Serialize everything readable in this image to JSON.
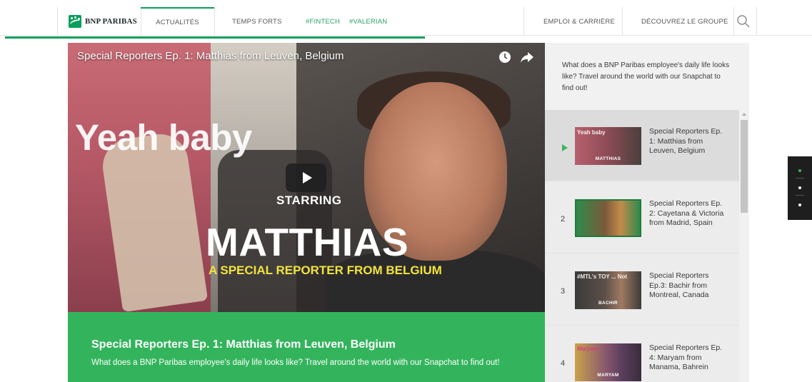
{
  "header": {
    "brand": "BNP PARIBAS",
    "nav_left": [
      "ACTUALITÉS",
      "TEMPS FORTS",
      "#FINTECH",
      "#VALERIAN"
    ],
    "nav_right": [
      "EMPLOI & CARRIÈRE",
      "DÉCOUVREZ LE GROUPE"
    ],
    "search_icon": "search-icon",
    "reading_progress": 0.52
  },
  "video": {
    "title": "Special Reporters Ep. 1: Matthias from Leuven, Belgium",
    "overlay_yeah": "Yeah baby",
    "overlay_starring": "STARRING",
    "overlay_name": "MATTHIAS",
    "overlay_subtitle": "A SPECIAL REPORTER FROM BELGIUM",
    "icons": [
      "clock-icon",
      "share-icon",
      "play-icon"
    ]
  },
  "caption": {
    "title": "Special Reporters Ep. 1: Matthias from Leuven, Belgium",
    "description": "What does a BNP Paribas employee's daily life looks like? Travel around the world with our Snapchat to find out!"
  },
  "sidebar": {
    "intro": "What does a BNP Paribas employee's daily life looks like? Travel around the world with our Snapchat to find out!",
    "playlist": [
      {
        "number": "",
        "active": true,
        "title": "Special Reporters Ep. 1: Matthias from Leuven, Belgium",
        "thumb_label": "MATTHIAS",
        "thumb_top": "Yeah baby"
      },
      {
        "number": "2",
        "active": false,
        "title": "Special Reporters Ep. 2: Cayetana & Victoria from Madrid, Spain",
        "thumb_label": "",
        "thumb_top": ""
      },
      {
        "number": "3",
        "active": false,
        "title": "Special Reporters Ep.3: Bachir from Montreal, Canada",
        "thumb_label": "BACHIR",
        "thumb_top": "#MTL's TOY ... Not"
      },
      {
        "number": "4",
        "active": false,
        "title": "Special Reporters Ep. 4: Maryam from Manama, Bahrein",
        "thumb_label": "MARYAM",
        "thumb_top": "Maryam"
      }
    ]
  },
  "dotnav": {
    "dots": 3,
    "active_index": 0
  },
  "colors": {
    "brand_green": "#0a9e5b",
    "caption_green": "#33b45c",
    "hashtag_green": "#2aa363",
    "overlay_yellow": "#f2e43e"
  }
}
